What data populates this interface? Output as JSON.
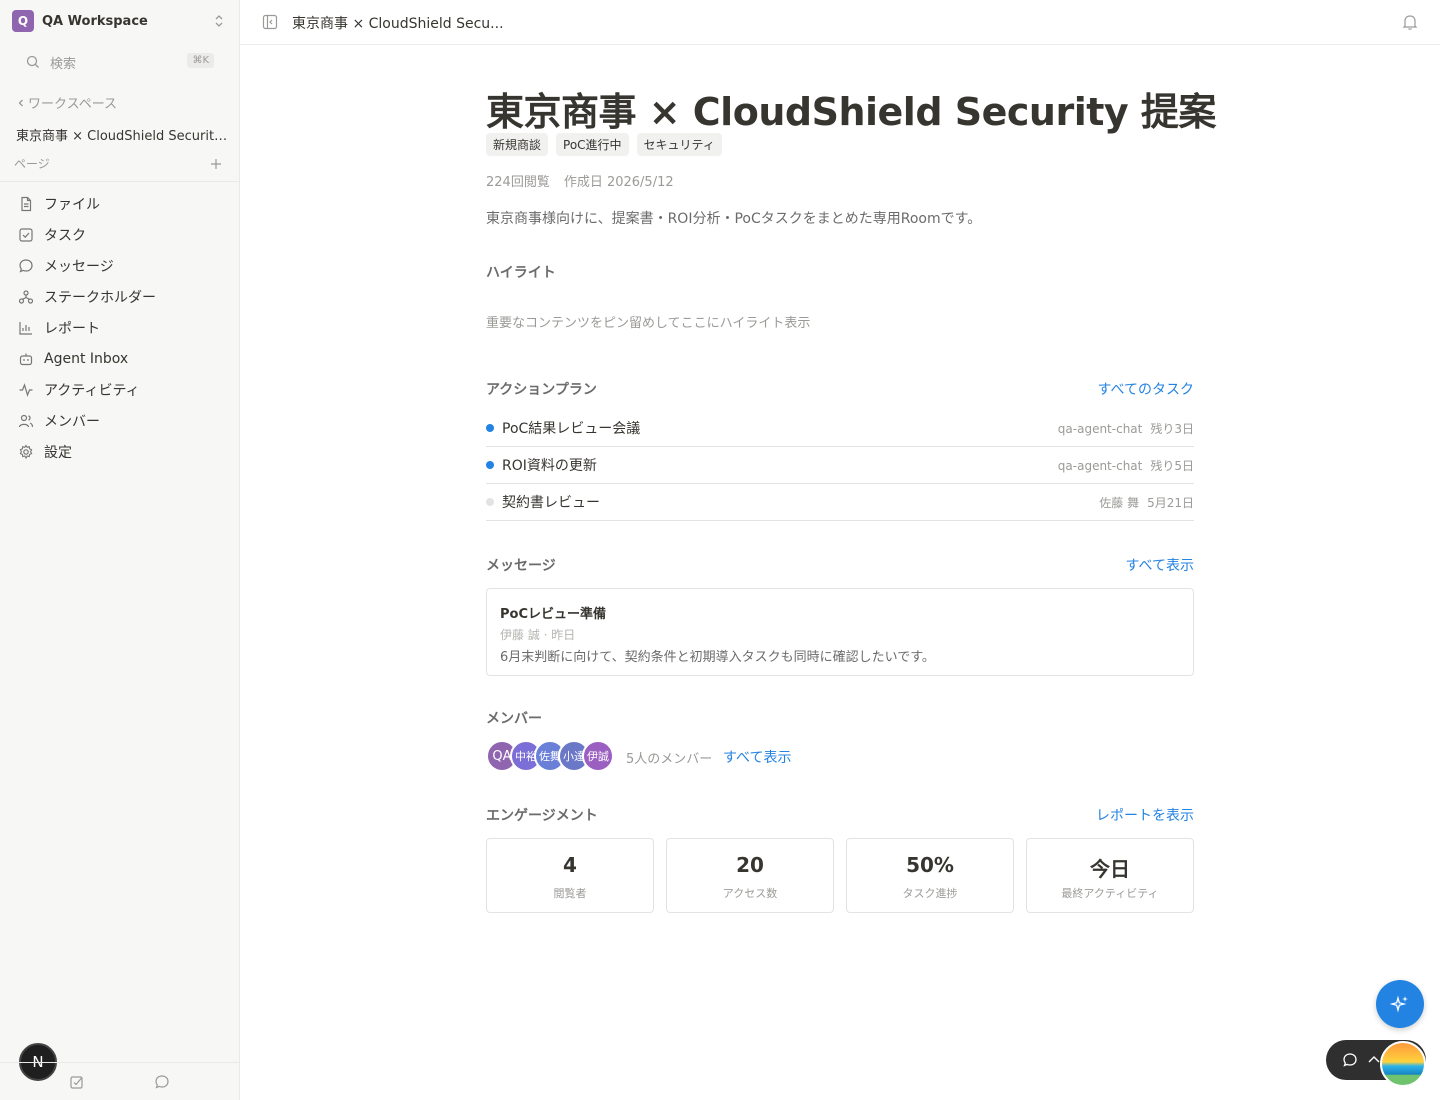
{
  "workspace": {
    "initial": "Q",
    "name": "QA Workspace"
  },
  "search": {
    "label": "検索",
    "shortcut": "⌘K"
  },
  "sidebar": {
    "back_label": "ワークスペース",
    "room_title": "東京商事 × CloudShield Security 提案",
    "pages_label": "ページ",
    "items": [
      {
        "icon": "file-icon",
        "label": "ファイル"
      },
      {
        "icon": "task-icon",
        "label": "タスク"
      },
      {
        "icon": "message-icon",
        "label": "メッセージ"
      },
      {
        "icon": "stakeholder-icon",
        "label": "ステークホルダー"
      },
      {
        "icon": "report-icon",
        "label": "レポート"
      },
      {
        "icon": "inbox-icon",
        "label": "Agent Inbox"
      },
      {
        "icon": "activity-icon",
        "label": "アクティビティ"
      },
      {
        "icon": "members-icon",
        "label": "メンバー"
      },
      {
        "icon": "gear-icon",
        "label": "設定"
      }
    ],
    "user_initial": "N"
  },
  "topbar": {
    "title": "東京商事 × CloudShield Secu..."
  },
  "page": {
    "title": "東京商事 × CloudShield Security 提案",
    "tags": [
      "新規商談",
      "PoC進行中",
      "セキュリティ"
    ],
    "views": "224回閲覧",
    "created": "作成日 2026/5/12",
    "description": "東京商事様向けに、提案書・ROI分析・PoCタスクをまとめた専用Roomです。"
  },
  "highlights": {
    "title": "ハイライト",
    "empty": "重要なコンテンツをピン留めしてここにハイライト表示"
  },
  "action_plan": {
    "title": "アクションプラン",
    "link": "すべてのタスク",
    "tasks": [
      {
        "name": "PoC結果レビュー会議",
        "assignee": "qa-agent-chat",
        "due": "残り3日",
        "dot": "#2383e2"
      },
      {
        "name": "ROI資料の更新",
        "assignee": "qa-agent-chat",
        "due": "残り5日",
        "dot": "#2383e2"
      },
      {
        "name": "契約書レビュー",
        "assignee": "佐藤 舞",
        "due": "5月21日",
        "dot": "#e3e3e1"
      }
    ]
  },
  "messages": {
    "title": "メッセージ",
    "link": "すべて表示",
    "items": [
      {
        "title": "PoCレビュー準備",
        "sub": "伊藤 誠 · 昨日",
        "body": "6月末判断に向けて、契約条件と初期導入タスクも同時に確認したいです。"
      }
    ]
  },
  "members": {
    "title": "メンバー",
    "avatars": [
      {
        "initials": "QA",
        "color": "#9065b0"
      },
      {
        "initials": "中裕",
        "color": "#7b6ed6"
      },
      {
        "initials": "佐舞",
        "color": "#6a7fd8"
      },
      {
        "initials": "小達",
        "color": "#6b78c8"
      },
      {
        "initials": "伊誠",
        "color": "#9a5fc0"
      }
    ],
    "count": "5人のメンバー",
    "link": "すべて表示"
  },
  "engagement": {
    "title": "エンゲージメント",
    "link": "レポートを表示",
    "stats": [
      {
        "value": "4",
        "label": "閲覧者"
      },
      {
        "value": "20",
        "label": "アクセス数"
      },
      {
        "value": "50%",
        "label": "タスク進捗"
      },
      {
        "value": "今日",
        "label": "最終アクティビティ"
      }
    ]
  },
  "colors": {
    "accent": "#2383e2",
    "workspace": "#9065b0"
  }
}
